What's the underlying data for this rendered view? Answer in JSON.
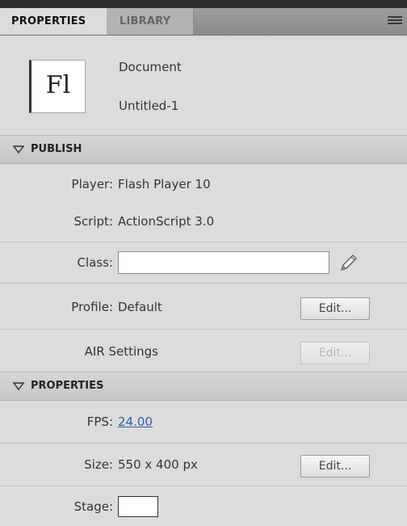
{
  "tabs": {
    "properties": "PROPERTIES",
    "library": "LIBRARY",
    "menu_icon": "panel-menu-icon"
  },
  "document": {
    "icon_text": "Fl",
    "type": "Document",
    "name": "Untitled-1"
  },
  "publish": {
    "header": "PUBLISH",
    "player_label": "Player:",
    "player_value": "Flash Player 10",
    "script_label": "Script:",
    "script_value": "ActionScript 3.0",
    "class_label": "Class:",
    "class_value": "",
    "profile_label": "Profile:",
    "profile_value": "Default",
    "profile_edit": "Edit...",
    "air_label": "AIR Settings",
    "air_edit": "Edit..."
  },
  "properties": {
    "header": "PROPERTIES",
    "fps_label": "FPS:",
    "fps_value": "24.00",
    "size_label": "Size:",
    "size_value": "550 x 400 px",
    "size_edit": "Edit...",
    "stage_label": "Stage:",
    "stage_color": "#ffffff"
  }
}
